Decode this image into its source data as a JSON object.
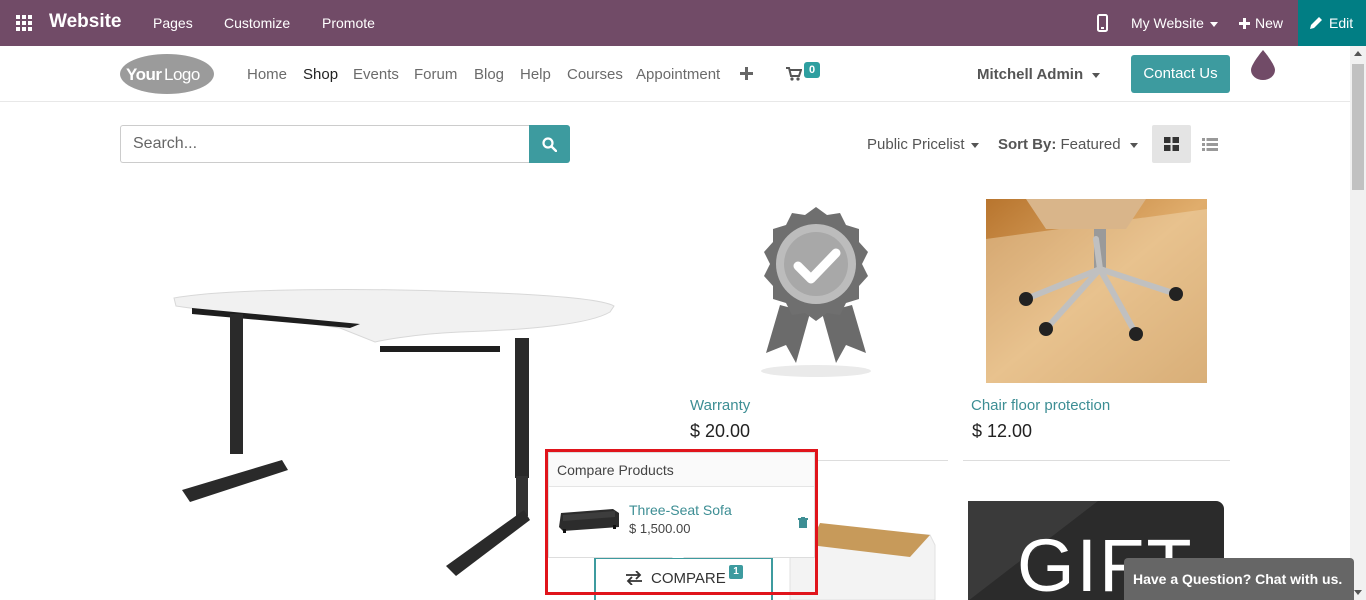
{
  "topbar": {
    "brand": "Website",
    "menu": [
      "Pages",
      "Customize",
      "Promote"
    ],
    "my_website": "My Website",
    "new_label": "New",
    "edit_label": "Edit"
  },
  "sitenav": {
    "logo_text": "YourLogo",
    "links": [
      "Home",
      "Shop",
      "Events",
      "Forum",
      "Blog",
      "Help",
      "Courses",
      "Appointment"
    ],
    "active": "Shop",
    "cart_count": "0",
    "user": "Mitchell Admin",
    "contact_label": "Contact Us"
  },
  "search": {
    "placeholder": "Search..."
  },
  "filters": {
    "pricelist": "Public Pricelist",
    "sort_prefix": "Sort By:",
    "sort_value": "Featured"
  },
  "products": [
    {
      "name": "Warranty",
      "price": "$ 20.00"
    },
    {
      "name": "Chair floor protection",
      "price": "$ 12.00"
    }
  ],
  "gift_text": "GIFT",
  "compare": {
    "title": "Compare Products",
    "item_name": "Three-Seat Sofa",
    "item_price": "$ 1,500.00",
    "button_label": "COMPARE",
    "count": "1"
  },
  "chat": {
    "label": "Have a Question? Chat with us."
  },
  "colors": {
    "topbar": "#714b67",
    "edit": "#017e84",
    "accent": "#3d9b9f",
    "highlight": "#e0141b"
  }
}
